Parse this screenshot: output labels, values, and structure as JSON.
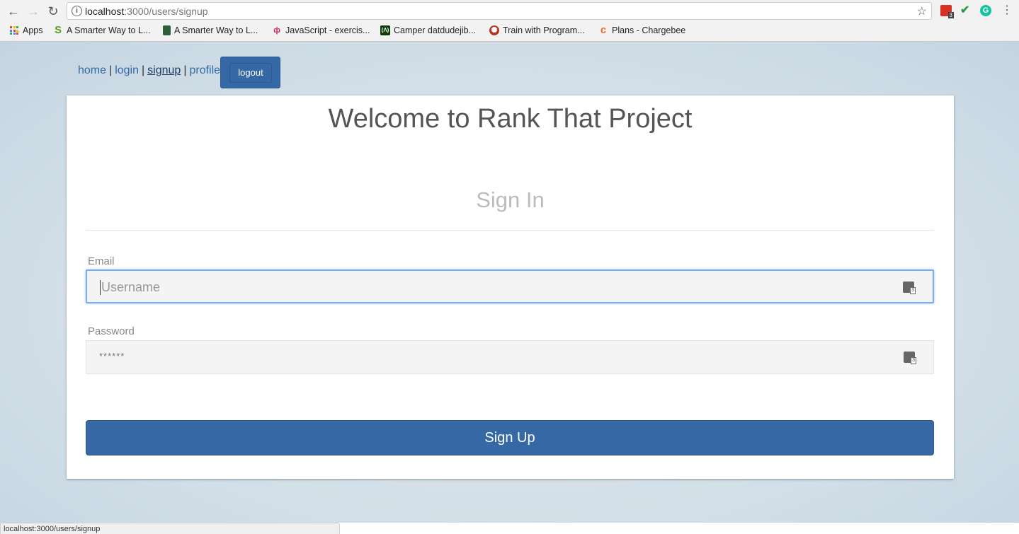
{
  "browser": {
    "url_host": "localhost",
    "url_path": ":3000/users/signup",
    "bookmarks": [
      {
        "label": "Apps",
        "icon": "apps-grid-icon"
      },
      {
        "label": "A Smarter Way to L...",
        "icon": "s-logo-icon",
        "color": "#5a9e1f"
      },
      {
        "label": "A Smarter Way to L...",
        "icon": "book-icon",
        "color": "#2e5e3a"
      },
      {
        "label": "JavaScript - exercis...",
        "icon": "exercism-icon",
        "color": "#c5285b"
      },
      {
        "label": "Camper datdudejib...",
        "icon": "freecodecamp-icon",
        "color": "#0a3d0a"
      },
      {
        "label": "Train with Program...",
        "icon": "codewars-icon",
        "color": "#b1361e"
      },
      {
        "label": "Plans - Chargebee",
        "icon": "chargebee-icon",
        "color": "#f06c2a"
      }
    ],
    "extension_badge": "3",
    "status_url": "localhost:3000/users/signup"
  },
  "nav": {
    "home": "home",
    "login": "login",
    "signup": "signup",
    "profile": "profile",
    "separator": "|",
    "logout": "logout"
  },
  "card": {
    "title": "Welcome to Rank That Project",
    "subtitle": "Sign In",
    "email_label": "Email",
    "email_placeholder": "Username",
    "password_label": "Password",
    "password_value": "******",
    "submit": "Sign Up",
    "field_icon_badge": "3"
  },
  "colors": {
    "primary": "#3568a4",
    "link": "#2f6aa7",
    "focus": "#78aef5"
  }
}
